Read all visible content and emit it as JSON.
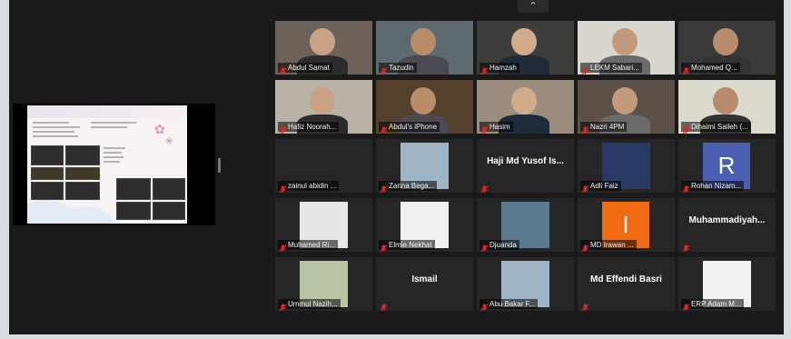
{
  "window": {
    "collapse_glyph": "⌃"
  },
  "accent": {
    "muted": "#e02626",
    "label_bg": "#000000",
    "avatar": "#4a5fb1",
    "orange": "#f06a12"
  },
  "participants": [
    {
      "name": "Abdul Samat",
      "kind": "video",
      "bg": "#6d6259"
    },
    {
      "name": "Tazudin",
      "kind": "video",
      "bg": "#5f6a70"
    },
    {
      "name": "Hamzah",
      "kind": "video",
      "bg": "#3f3d3b"
    },
    {
      "name": "LEKM Sabari...",
      "kind": "video",
      "bg": "#d8d6cf"
    },
    {
      "name": "Mohamed Q...",
      "kind": "video",
      "bg": "#3a3a3a"
    },
    {
      "name": "Hafiz Noorah...",
      "kind": "video",
      "bg": "#b9b2a7"
    },
    {
      "name": "Abdul's iPhone",
      "kind": "video",
      "bg": "#54402c"
    },
    {
      "name": "Hasim",
      "kind": "video",
      "bg": "#9b8d7e"
    },
    {
      "name": "Nazri 4PM",
      "kind": "video",
      "bg": "#5b5148"
    },
    {
      "name": "Dihaimi Saileh (...",
      "kind": "video",
      "bg": "#dcd9cf"
    },
    {
      "name": "zainul abidin ...",
      "kind": "empty"
    },
    {
      "name": "Zarina Bega...",
      "kind": "photo",
      "bg": "#9fb4c4"
    },
    {
      "name": "Haji Md Yusof Is...",
      "kind": "text"
    },
    {
      "name": "Adli Faiz",
      "kind": "photo",
      "bg": "#2a3a66"
    },
    {
      "name": "Rohan Nizam...",
      "kind": "avatar",
      "letter": "R"
    },
    {
      "name": "Muhamed Ri...",
      "kind": "photo",
      "bg": "#e7e7e7"
    },
    {
      "name": "Elmie Nekhat",
      "kind": "photo",
      "bg": "#f0f0f0"
    },
    {
      "name": "Djuanda",
      "kind": "photo",
      "bg": "#5c7b8e"
    },
    {
      "name": "MD Irawan ...",
      "kind": "letter",
      "letter": "I"
    },
    {
      "name": "Muhammadiyah...",
      "kind": "text"
    },
    {
      "name": "Ummul Nazih...",
      "kind": "photo",
      "bg": "#b9c4a5"
    },
    {
      "name": "Ismail",
      "kind": "text"
    },
    {
      "name": "Abu Bakar F...",
      "kind": "photo",
      "bg": "#9fb4c4"
    },
    {
      "name": "Md Effendi Basri",
      "kind": "text"
    },
    {
      "name": "ERP Adam M...",
      "kind": "photo",
      "bg": "#f2f2f2"
    }
  ]
}
